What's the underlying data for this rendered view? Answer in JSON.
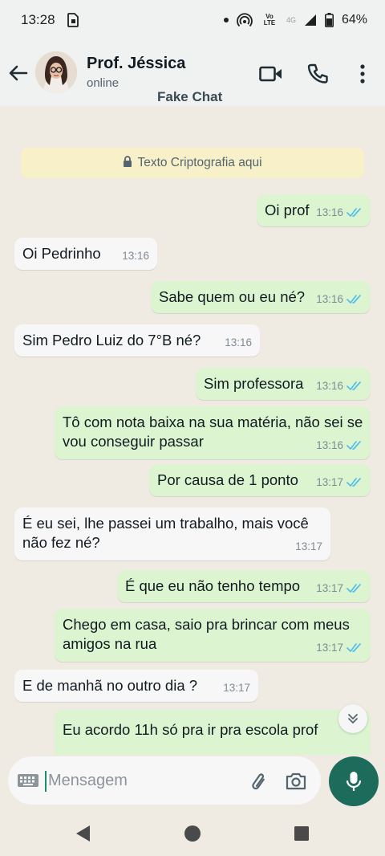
{
  "status_bar": {
    "time": "13:28",
    "lte_label": "Vo LTE",
    "net_label": "4G",
    "battery": "64%"
  },
  "header": {
    "contact_name": "Prof. Jéssica",
    "status": "online",
    "watermark": "Fake Chat"
  },
  "encryption_notice": "Texto Criptografia aqui",
  "messages": [
    {
      "dir": "out",
      "text": "Oi prof",
      "time": "13:16",
      "read": true
    },
    {
      "dir": "in",
      "text": "Oi Pedrinho",
      "time": "13:16"
    },
    {
      "dir": "out",
      "text": "Sabe quem ou eu né?",
      "time": "13:16",
      "read": true
    },
    {
      "dir": "in",
      "text": "Sim Pedro Luiz do 7°B né?",
      "time": "13:16"
    },
    {
      "dir": "out",
      "text": "Sim professora",
      "time": "13:16",
      "read": true
    },
    {
      "dir": "out",
      "text": "Tô com nota baixa na sua matéria, não sei se vou conseguir passar",
      "time": "13:16",
      "read": true
    },
    {
      "dir": "out",
      "text": "Por causa de 1 ponto",
      "time": "13:17",
      "read": true
    },
    {
      "dir": "in",
      "text": "É eu sei, lhe passei um trabalho, mais você não fez né?",
      "time": "13:17"
    },
    {
      "dir": "out",
      "text": "É que eu não tenho tempo",
      "time": "13:17",
      "read": true
    },
    {
      "dir": "out",
      "text": "Chego em casa, saio pra brincar com meus amigos na rua",
      "time": "13:17",
      "read": true
    },
    {
      "dir": "in",
      "text": "E de manhã no outro dia ?",
      "time": "13:17"
    },
    {
      "dir": "out",
      "text": "Eu acordo 11h só pra ir pra escola prof",
      "time": "",
      "read": true
    }
  ],
  "input": {
    "placeholder": "Mensagem"
  },
  "colors": {
    "outgoing_bubble": "#dcf5d0",
    "incoming_bubble": "#f7f7f7",
    "chat_background": "#efeae2",
    "mic_button": "#1d6b5b",
    "read_ticks": "#53bdeb"
  },
  "icons": {
    "back": "arrow-left-icon",
    "video": "video-call-icon",
    "call": "phone-icon",
    "menu": "more-vert-icon",
    "lock": "lock-icon",
    "keyboard": "keyboard-icon",
    "attach": "paperclip-icon",
    "camera": "camera-icon",
    "mic": "mic-icon",
    "scroll": "chevron-double-down-icon"
  }
}
